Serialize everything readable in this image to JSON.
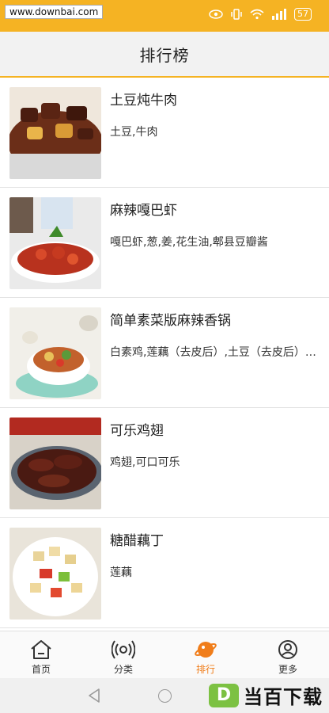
{
  "watermark": "www.downbai.com",
  "status": {
    "battery": "57"
  },
  "header": {
    "title": "排行榜"
  },
  "recipes": [
    {
      "name": "土豆炖牛肉",
      "ingredients": "土豆,牛肉"
    },
    {
      "name": "麻辣嘎巴虾",
      "ingredients": "嘎巴虾,葱,姜,花生油,郫县豆瓣酱"
    },
    {
      "name": "简单素菜版麻辣香锅",
      "ingredients": "白素鸡,莲藕（去皮后）,土豆（去皮后）,花菜"
    },
    {
      "name": "可乐鸡翅",
      "ingredients": "鸡翅,可口可乐"
    },
    {
      "name": "糖醋藕丁",
      "ingredients": "莲藕"
    }
  ],
  "tabs": [
    {
      "label": "首页",
      "icon": "home-icon"
    },
    {
      "label": "分类",
      "icon": "radar-icon"
    },
    {
      "label": "排行",
      "icon": "planet-icon"
    },
    {
      "label": "更多",
      "icon": "user-circle-icon"
    }
  ],
  "colors": {
    "accent": "#f5b323",
    "active_tab": "#f07d1a"
  },
  "brand": {
    "badge": "D",
    "text": "当百下载"
  }
}
